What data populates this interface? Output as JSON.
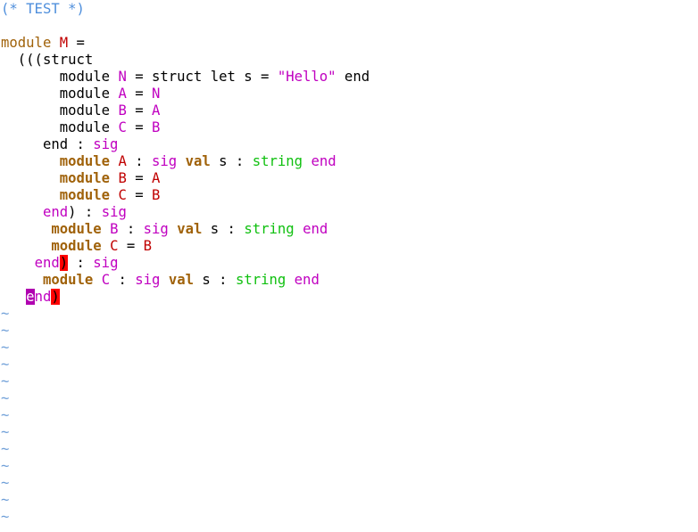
{
  "editor": {
    "name": "vim",
    "colors": {
      "comment": "#4f8fdc",
      "keyword_bold": "#a0620a",
      "keyword_orange": "#a0620a",
      "module_name": "#c000c0",
      "constructor": "#c00000",
      "text": "#000000",
      "string": "#c000c0",
      "type_green": "#10c010",
      "sig_magenta": "#c000c0",
      "tilde": "#6f9fd8",
      "match_paren_bg": "#ff0000",
      "cursor_bg": "#b000b0"
    },
    "lines": [
      [
        {
          "t": "(* TEST *)",
          "c": "comment"
        }
      ],
      [],
      [
        {
          "t": "module",
          "c": "keyword_orange"
        },
        {
          "t": " "
        },
        {
          "t": "M",
          "c": "constructor"
        },
        {
          "t": " ="
        }
      ],
      [
        {
          "t": "  (((struct"
        }
      ],
      [
        {
          "t": "       module "
        },
        {
          "t": "N",
          "c": "module_name"
        },
        {
          "t": " = struct let s = "
        },
        {
          "t": "\"Hello\"",
          "c": "string"
        },
        {
          "t": " end"
        }
      ],
      [
        {
          "t": "       module "
        },
        {
          "t": "A",
          "c": "module_name"
        },
        {
          "t": " = "
        },
        {
          "t": "N",
          "c": "module_name"
        }
      ],
      [
        {
          "t": "       module "
        },
        {
          "t": "B",
          "c": "module_name"
        },
        {
          "t": " = "
        },
        {
          "t": "A",
          "c": "module_name"
        }
      ],
      [
        {
          "t": "       module "
        },
        {
          "t": "C",
          "c": "module_name"
        },
        {
          "t": " = "
        },
        {
          "t": "B",
          "c": "module_name"
        }
      ],
      [
        {
          "t": "     end : "
        },
        {
          "t": "sig",
          "c": "sig_magenta"
        }
      ],
      [
        {
          "t": "       "
        },
        {
          "t": "module",
          "c": "keyword_bold",
          "b": true
        },
        {
          "t": " "
        },
        {
          "t": "A",
          "c": "constructor"
        },
        {
          "t": " : "
        },
        {
          "t": "sig",
          "c": "sig_magenta"
        },
        {
          "t": " "
        },
        {
          "t": "val",
          "c": "keyword_bold",
          "b": true
        },
        {
          "t": " s : "
        },
        {
          "t": "string",
          "c": "type_green"
        },
        {
          "t": " "
        },
        {
          "t": "end",
          "c": "sig_magenta"
        }
      ],
      [
        {
          "t": "       "
        },
        {
          "t": "module",
          "c": "keyword_bold",
          "b": true
        },
        {
          "t": " "
        },
        {
          "t": "B",
          "c": "constructor"
        },
        {
          "t": " = "
        },
        {
          "t": "A",
          "c": "constructor"
        }
      ],
      [
        {
          "t": "       "
        },
        {
          "t": "module",
          "c": "keyword_bold",
          "b": true
        },
        {
          "t": " "
        },
        {
          "t": "C",
          "c": "constructor"
        },
        {
          "t": " = "
        },
        {
          "t": "B",
          "c": "constructor"
        }
      ],
      [
        {
          "t": "     "
        },
        {
          "t": "end",
          "c": "sig_magenta"
        },
        {
          "t": ") : "
        },
        {
          "t": "sig",
          "c": "sig_magenta"
        }
      ],
      [
        {
          "t": "      "
        },
        {
          "t": "module",
          "c": "keyword_bold",
          "b": true
        },
        {
          "t": " "
        },
        {
          "t": "B",
          "c": "module_name"
        },
        {
          "t": " : "
        },
        {
          "t": "sig",
          "c": "sig_magenta"
        },
        {
          "t": " "
        },
        {
          "t": "val",
          "c": "keyword_bold",
          "b": true
        },
        {
          "t": " s : "
        },
        {
          "t": "string",
          "c": "type_green"
        },
        {
          "t": " "
        },
        {
          "t": "end",
          "c": "sig_magenta"
        }
      ],
      [
        {
          "t": "      "
        },
        {
          "t": "module",
          "c": "keyword_bold",
          "b": true
        },
        {
          "t": " "
        },
        {
          "t": "C",
          "c": "constructor"
        },
        {
          "t": " = "
        },
        {
          "t": "B",
          "c": "constructor"
        }
      ],
      [
        {
          "t": "    "
        },
        {
          "t": "end",
          "c": "sig_magenta"
        },
        {
          "t": ")",
          "hl": "match"
        },
        {
          "t": " : "
        },
        {
          "t": "sig",
          "c": "sig_magenta"
        }
      ],
      [
        {
          "t": "     "
        },
        {
          "t": "module",
          "c": "keyword_bold",
          "b": true
        },
        {
          "t": " "
        },
        {
          "t": "C",
          "c": "module_name"
        },
        {
          "t": " : "
        },
        {
          "t": "sig",
          "c": "sig_magenta"
        },
        {
          "t": " "
        },
        {
          "t": "val",
          "c": "keyword_bold",
          "b": true
        },
        {
          "t": " s : "
        },
        {
          "t": "string",
          "c": "type_green"
        },
        {
          "t": " "
        },
        {
          "t": "end",
          "c": "sig_magenta"
        }
      ],
      [
        {
          "t": "   "
        },
        {
          "t": "e",
          "hl": "cursor"
        },
        {
          "t": "nd",
          "c": "sig_magenta"
        },
        {
          "t": ")",
          "hl": "match"
        }
      ]
    ],
    "tilde_char": "~",
    "tilde_count": 13
  }
}
